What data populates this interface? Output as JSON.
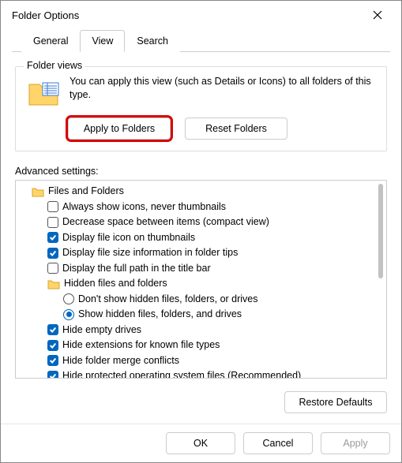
{
  "window": {
    "title": "Folder Options"
  },
  "tabs": {
    "general": "General",
    "view": "View",
    "search": "Search",
    "active": "view"
  },
  "folder_views": {
    "legend": "Folder views",
    "desc": "You can apply this view (such as Details or Icons) to all folders of this type.",
    "apply_btn": "Apply to Folders",
    "reset_btn": "Reset Folders"
  },
  "advanced": {
    "label": "Advanced settings:",
    "group_label": "Files and Folders",
    "items": [
      {
        "kind": "check",
        "checked": false,
        "label": "Always show icons, never thumbnails"
      },
      {
        "kind": "check",
        "checked": false,
        "label": "Decrease space between items (compact view)"
      },
      {
        "kind": "check",
        "checked": true,
        "label": "Display file icon on thumbnails"
      },
      {
        "kind": "check",
        "checked": true,
        "label": "Display file size information in folder tips"
      },
      {
        "kind": "check",
        "checked": false,
        "label": "Display the full path in the title bar"
      },
      {
        "kind": "folder",
        "label": "Hidden files and folders"
      },
      {
        "kind": "radio",
        "selected": false,
        "label": "Don't show hidden files, folders, or drives"
      },
      {
        "kind": "radio",
        "selected": true,
        "label": "Show hidden files, folders, and drives"
      },
      {
        "kind": "check",
        "checked": true,
        "label": "Hide empty drives"
      },
      {
        "kind": "check",
        "checked": true,
        "label": "Hide extensions for known file types"
      },
      {
        "kind": "check",
        "checked": true,
        "label": "Hide folder merge conflicts"
      },
      {
        "kind": "check",
        "checked": true,
        "label": "Hide protected operating system files (Recommended)"
      }
    ],
    "restore_btn": "Restore Defaults"
  },
  "buttons": {
    "ok": "OK",
    "cancel": "Cancel",
    "apply": "Apply"
  }
}
